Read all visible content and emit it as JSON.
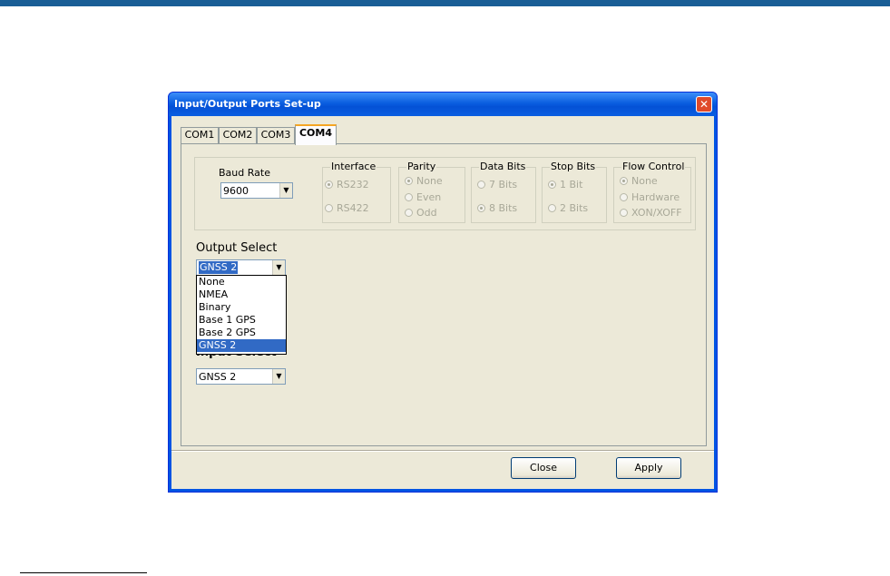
{
  "dialog": {
    "title": "Input/Output Ports Set-up",
    "close_glyph": "✕"
  },
  "tabs": [
    {
      "label": "COM1",
      "active": false
    },
    {
      "label": "COM2",
      "active": false
    },
    {
      "label": "COM3",
      "active": false
    },
    {
      "label": "COM4",
      "active": true
    }
  ],
  "baud": {
    "label": "Baud Rate",
    "value": "9600"
  },
  "interface": {
    "label": "Interface",
    "options": [
      "RS232",
      "RS422"
    ],
    "selected": "RS232"
  },
  "parity": {
    "label": "Parity",
    "options": [
      "None",
      "Even",
      "Odd"
    ],
    "selected": "None"
  },
  "data_bits": {
    "label": "Data Bits",
    "options": [
      "7 Bits",
      "8 Bits"
    ],
    "selected": "8 Bits"
  },
  "stop_bits": {
    "label": "Stop Bits",
    "options": [
      "1 Bit",
      "2 Bits"
    ],
    "selected": "1 Bit"
  },
  "flow_control": {
    "label": "Flow Control",
    "options": [
      "None",
      "Hardware",
      "XON/XOFF"
    ],
    "selected": "None"
  },
  "output_select": {
    "label": "Output Select",
    "value": "GNSS 2",
    "options": [
      "None",
      "NMEA",
      "Binary",
      "Base 1 GPS",
      "Base 2 GPS",
      "GNSS 2"
    ]
  },
  "input_select": {
    "label": "Input Select",
    "value": "GNSS 2"
  },
  "buttons": {
    "close": "Close",
    "apply": "Apply"
  },
  "colors": {
    "titlebar": "#0a5ee0",
    "selection": "#316ac5",
    "dialog_bg": "#ece9d8",
    "page_topbar": "#1a5e96"
  }
}
